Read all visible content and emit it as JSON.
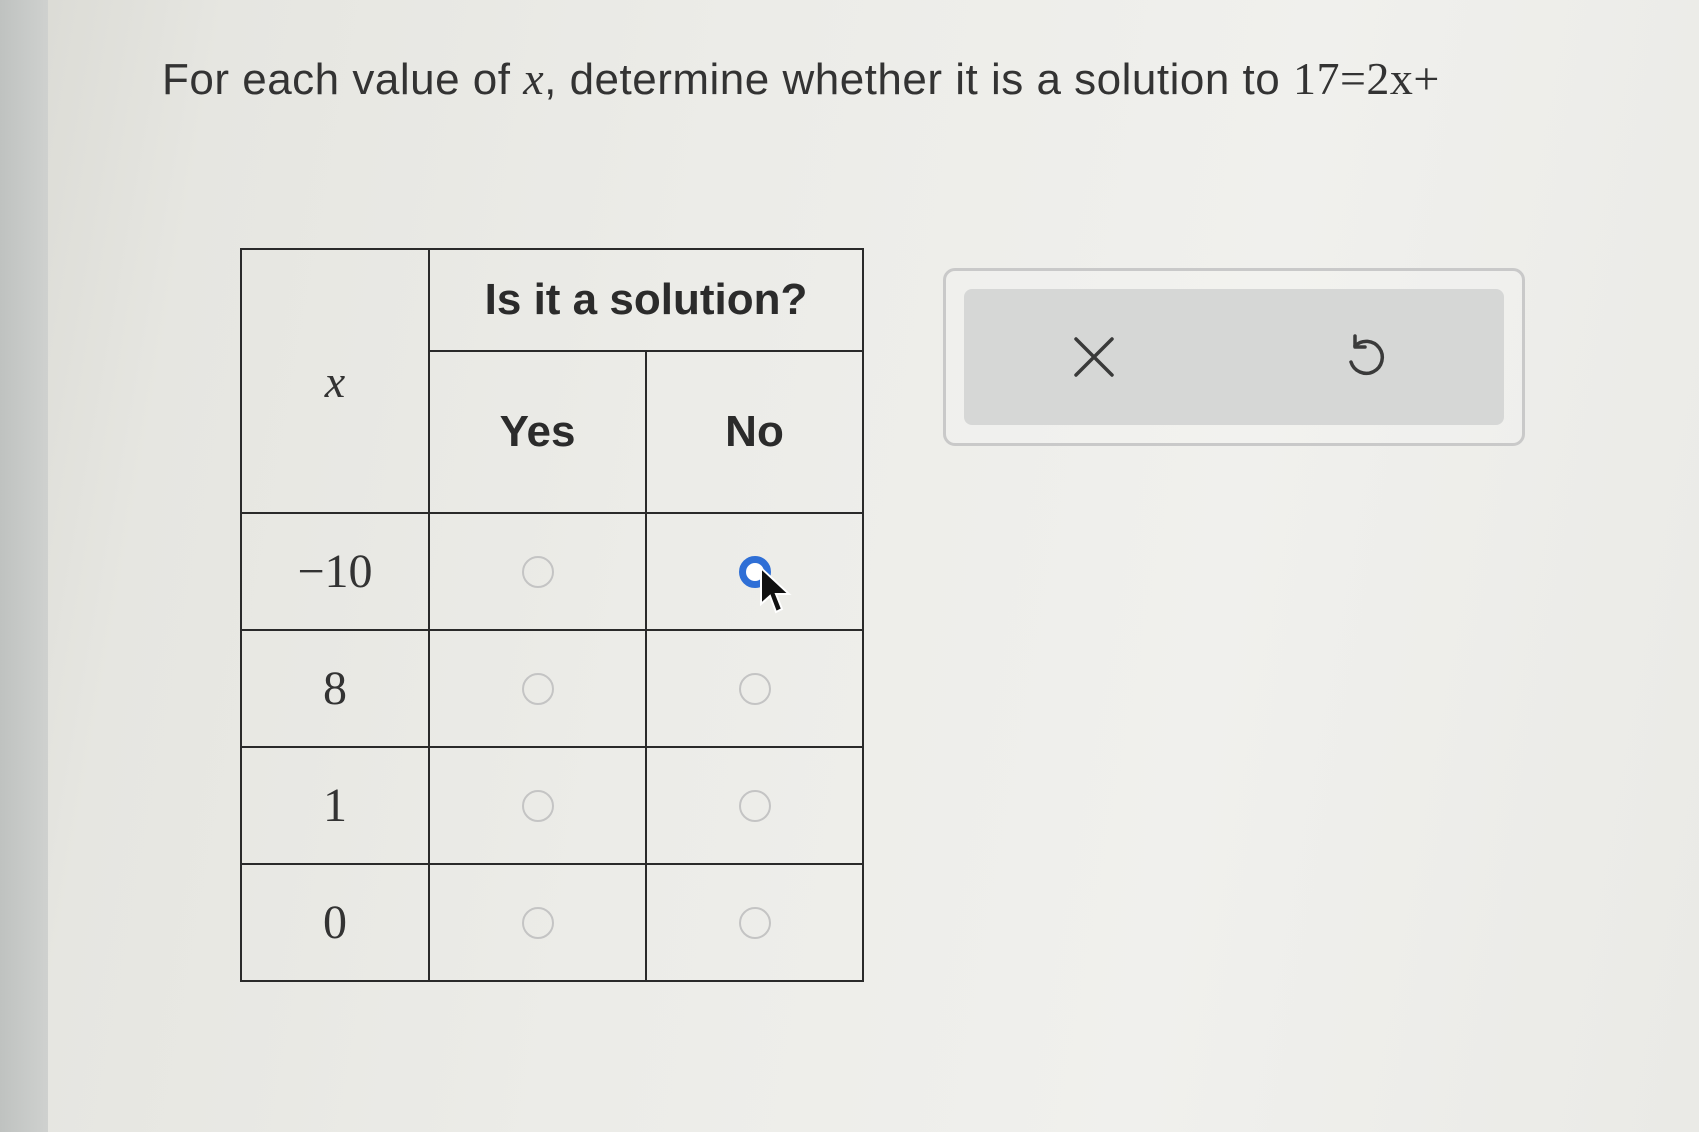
{
  "question": {
    "prefix": "For each value of ",
    "variable": "x",
    "middle": ", determine whether it is a solution to ",
    "equation": "17=2x+"
  },
  "table": {
    "x_header": "x",
    "solution_header": "Is it a solution?",
    "yes_label": "Yes",
    "no_label": "No",
    "rows": [
      {
        "x": "−10",
        "yes_selected": false,
        "no_selected": true
      },
      {
        "x": "8",
        "yes_selected": false,
        "no_selected": false
      },
      {
        "x": "1",
        "yes_selected": false,
        "no_selected": false
      },
      {
        "x": "0",
        "yes_selected": false,
        "no_selected": false
      }
    ]
  },
  "toolbar": {
    "close_icon": "x-icon",
    "undo_icon": "undo-icon"
  },
  "colors": {
    "selected_radio": "#2f6fd6",
    "border": "#2a2a2a"
  }
}
